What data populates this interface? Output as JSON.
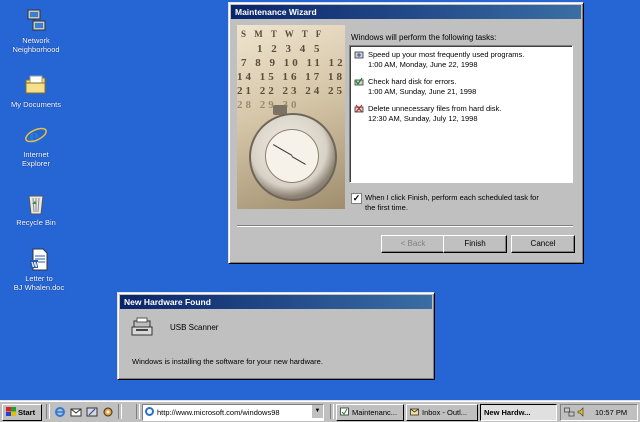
{
  "desktop": {
    "icons": [
      {
        "label_line1": "Network",
        "label_line2": "Neighborhood",
        "icon": "network-neighborhood-icon"
      },
      {
        "label_line1": "My Documents",
        "label_line2": "",
        "icon": "folder-icon"
      },
      {
        "label_line1": "Internet",
        "label_line2": "Explorer",
        "icon": "internet-explorer-icon"
      },
      {
        "label_line1": "Recycle Bin",
        "label_line2": "",
        "icon": "recycle-bin-icon"
      },
      {
        "label_line1": "Letter to",
        "label_line2": "BJ Whalen.doc",
        "icon": "word-document-icon"
      }
    ]
  },
  "wizard": {
    "title": "Maintenance Wizard",
    "heading": "Windows will perform the following tasks:",
    "calendar_rows": [
      "S M T W T F",
      "1 2 3 4 5",
      "7 8 9 10 11 12",
      "14 15 16 17 18 19",
      "21 22 23 24 25 26",
      "28 29 30"
    ],
    "tasks": [
      {
        "icon": "speed-up-programs-icon",
        "line1": "Speed up your most frequently used programs.",
        "line2": "1:00 AM, Monday, June 22, 1998"
      },
      {
        "icon": "check-disk-icon",
        "line1": "Check hard disk for errors.",
        "line2": "1:00 AM, Sunday, June 21, 1998"
      },
      {
        "icon": "delete-files-icon",
        "line1": "Delete unnecessary files from hard disk.",
        "line2": "12:30 AM, Sunday, July 12, 1998"
      }
    ],
    "checkbox_checked": true,
    "checkbox_mark": "✓",
    "checkbox_line1": "When I click Finish, perform each scheduled task for",
    "checkbox_line2": "the first time.",
    "back_label": "< Back",
    "finish_label": "Finish",
    "cancel_label": "Cancel"
  },
  "hardware": {
    "title": "New Hardware Found",
    "device": "USB Scanner",
    "message": "Windows is installing the software for your new hardware."
  },
  "taskbar": {
    "start_label": "Start",
    "quick_launch": [
      "internet-explorer-icon",
      "outlook-express-icon",
      "show-desktop-icon",
      "channels-icon"
    ],
    "address": "http://www.microsoft.com/windows98",
    "buttons": [
      {
        "label": "Maintenanc...",
        "icon": "maintenance-icon",
        "active": false
      },
      {
        "label": "Inbox - Outl...",
        "icon": "inbox-icon",
        "active": false
      },
      {
        "label": "New Hardw...",
        "icon": "",
        "active": true
      }
    ],
    "clock": "10:57 PM",
    "tray_icons": [
      "network-tray-icon",
      "volume-icon"
    ]
  }
}
